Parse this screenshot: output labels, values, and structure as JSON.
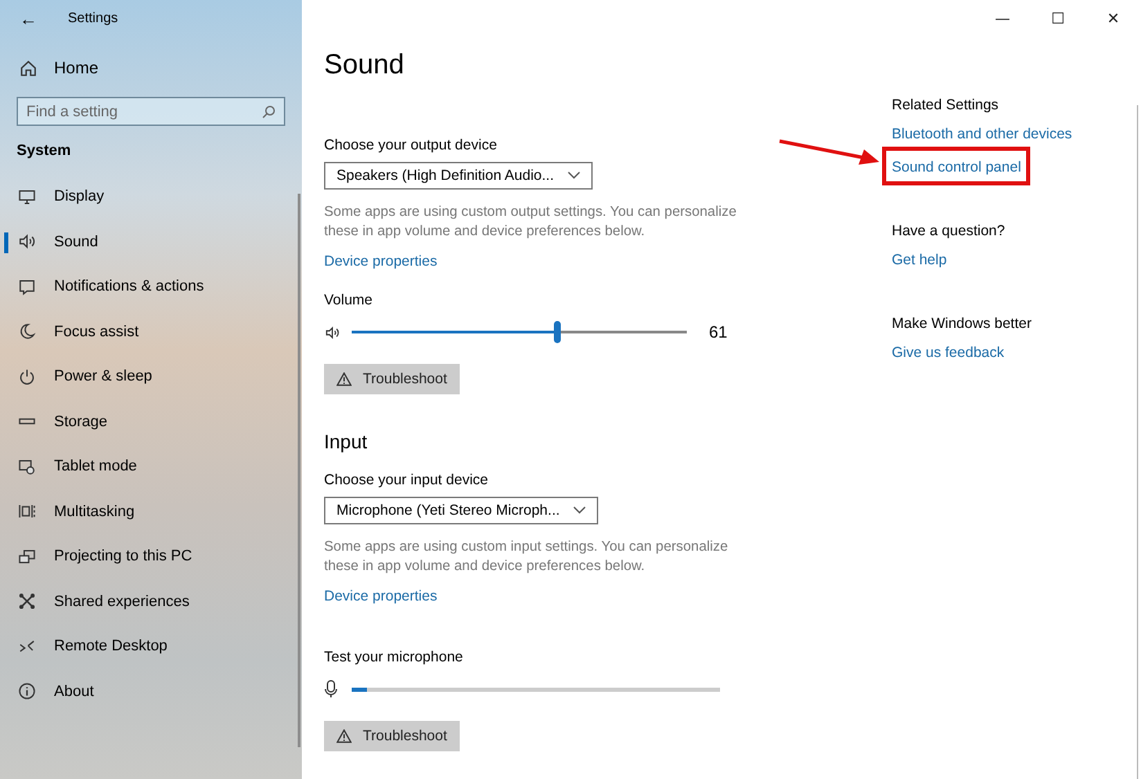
{
  "window": {
    "title": "Settings",
    "back": "←",
    "controls": [
      "—",
      "☐",
      "✕"
    ]
  },
  "sidebar": {
    "home": "Home",
    "search": {
      "placeholder": "Find a setting"
    },
    "section": "System",
    "items": [
      {
        "label": "Display",
        "selected": false
      },
      {
        "label": "Sound",
        "selected": true
      },
      {
        "label": "Notifications & actions",
        "selected": false
      },
      {
        "label": "Focus assist",
        "selected": false
      },
      {
        "label": "Power & sleep",
        "selected": false
      },
      {
        "label": "Storage",
        "selected": false
      },
      {
        "label": "Tablet mode",
        "selected": false
      },
      {
        "label": "Multitasking",
        "selected": false
      },
      {
        "label": "Projecting to this PC",
        "selected": false
      },
      {
        "label": "Shared experiences",
        "selected": false
      },
      {
        "label": "Remote Desktop",
        "selected": false
      },
      {
        "label": "About",
        "selected": false
      }
    ]
  },
  "page": {
    "title": "Sound",
    "output": {
      "label": "Choose your output device",
      "device": "Speakers (High Definition Audio...",
      "note": "Some apps are using custom output settings. You can personalize these in app volume and device preferences below.",
      "link": "Device properties",
      "volume_label": "Volume",
      "volume": {
        "level": 0.61
      },
      "volume_reading": "61",
      "troubleshoot": "Troubleshoot"
    },
    "input_title": "Input",
    "input": {
      "label": "Choose your input device",
      "device": "Microphone (Yeti Stereo Microph...",
      "note": "Some apps are using custom input settings. You can personalize these in app volume and device preferences below.",
      "link": "Device properties",
      "test_label": "Test your microphone",
      "mic": {
        "level": 0.04
      },
      "troubleshoot": "Troubleshoot"
    }
  },
  "related": [
    {
      "heading": "Related Settings",
      "links": [
        {
          "label": "Bluetooth and other devices",
          "highlighted": false
        },
        {
          "label": "Sound control panel",
          "highlighted": true
        }
      ]
    },
    {
      "heading": "Have a question?",
      "links": [
        {
          "label": "Get help",
          "highlighted": false
        }
      ]
    },
    {
      "heading": "Make Windows better",
      "links": [
        {
          "label": "Give us feedback",
          "highlighted": false
        }
      ]
    }
  ]
}
